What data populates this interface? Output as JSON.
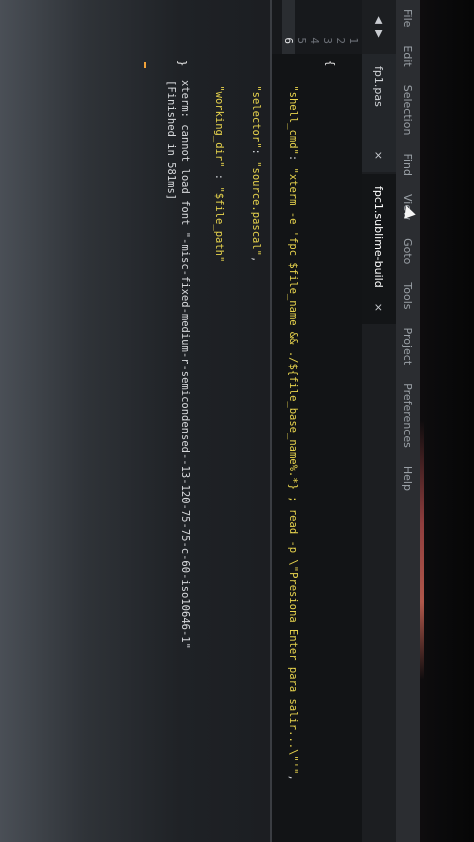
{
  "menubar": {
    "items": [
      "File",
      "Edit",
      "Selection",
      "Find",
      "View",
      "Goto",
      "Tools",
      "Project",
      "Preferences",
      "Help"
    ]
  },
  "tabbar": {
    "nav_prev": "◀",
    "nav_next": "▶",
    "tabs": [
      {
        "label": "fp1.pas",
        "close": "×"
      },
      {
        "label": "fpc1.sublime-build",
        "close": "×"
      }
    ]
  },
  "editor": {
    "line_numbers": [
      "1",
      "2",
      "3",
      "4",
      "5",
      "6"
    ],
    "lines": [
      {
        "open_brace": "{"
      },
      {
        "key": "\"shell_cmd\"",
        "sep": ": ",
        "value": "\"xterm -e 'fpc $file_name && ./${file_base_name%.*} ; read -p \\\"Presiona Enter para salir...\\\"'\"",
        "tail": ","
      },
      {
        "key": "\"selector\"",
        "sep": ": ",
        "value": "\"source.pascal\"",
        "tail": ","
      },
      {
        "key": "\"working_dir\"",
        "sep": " : ",
        "value": "\"$file_path\"",
        "tail": ""
      },
      {
        "close_brace": "}"
      },
      {
        "empty": ""
      }
    ]
  },
  "console": {
    "lines": [
      "xterm: cannot load font \"-misc-fixed-medium-r-semicondensed--13-120-75-75-c-60-iso10646-1\"",
      "[Finished in 581ms]"
    ]
  },
  "colors": {
    "string": "#e8d44d",
    "caret": "#f2a33a"
  }
}
